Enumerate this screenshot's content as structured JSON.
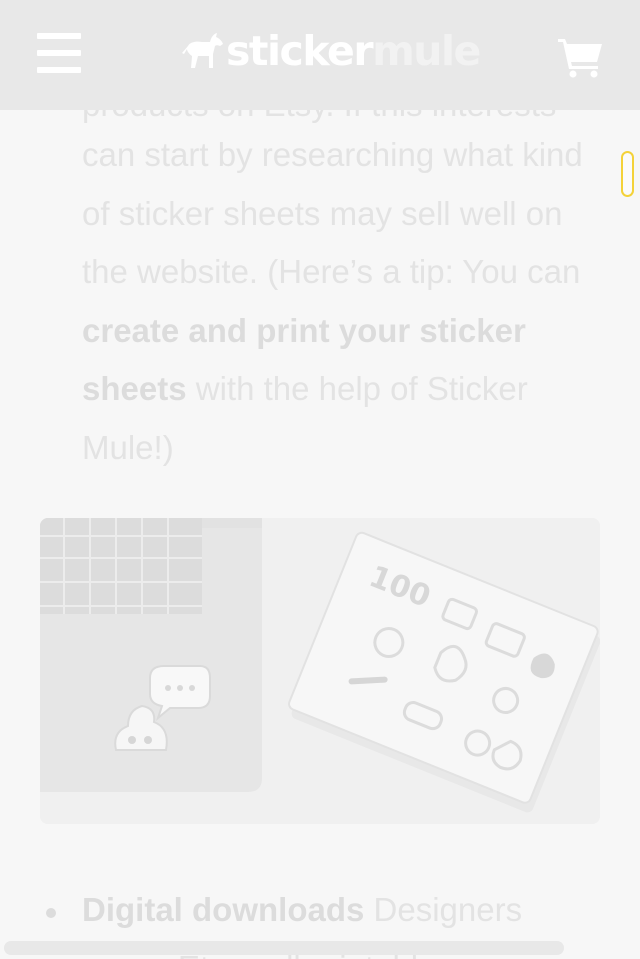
{
  "header": {
    "menu_icon": "hamburger-menu-icon",
    "logo": {
      "word_sticker": "sticker",
      "word_mule": "mule",
      "icon": "mule-horse-icon"
    },
    "cart_icon": "shopping-cart-icon"
  },
  "article": {
    "partial_line": "products on Etsy. If this interests you,",
    "lines_before_bold": "can start by researching what kind of sticker sheets may sell well on the website. (Here’s a tip: You can ",
    "bold_link": "create and print your sticker sheets",
    "after_bold": " with the help of Sticker Mule!)"
  },
  "photo": {
    "description_icon": "laptop-and-sticker-sheets-image"
  },
  "bullets": [
    {
      "bold": "Digital downloads",
      "text": " Designers",
      "continuation": "on Etsy sell printables"
    }
  ],
  "colors": {
    "header_bg": "#e8e8e8",
    "page_bg": "#f7f7f7",
    "text": "#e3e3e3",
    "scroll_thumb_border": "#f4d23a"
  }
}
